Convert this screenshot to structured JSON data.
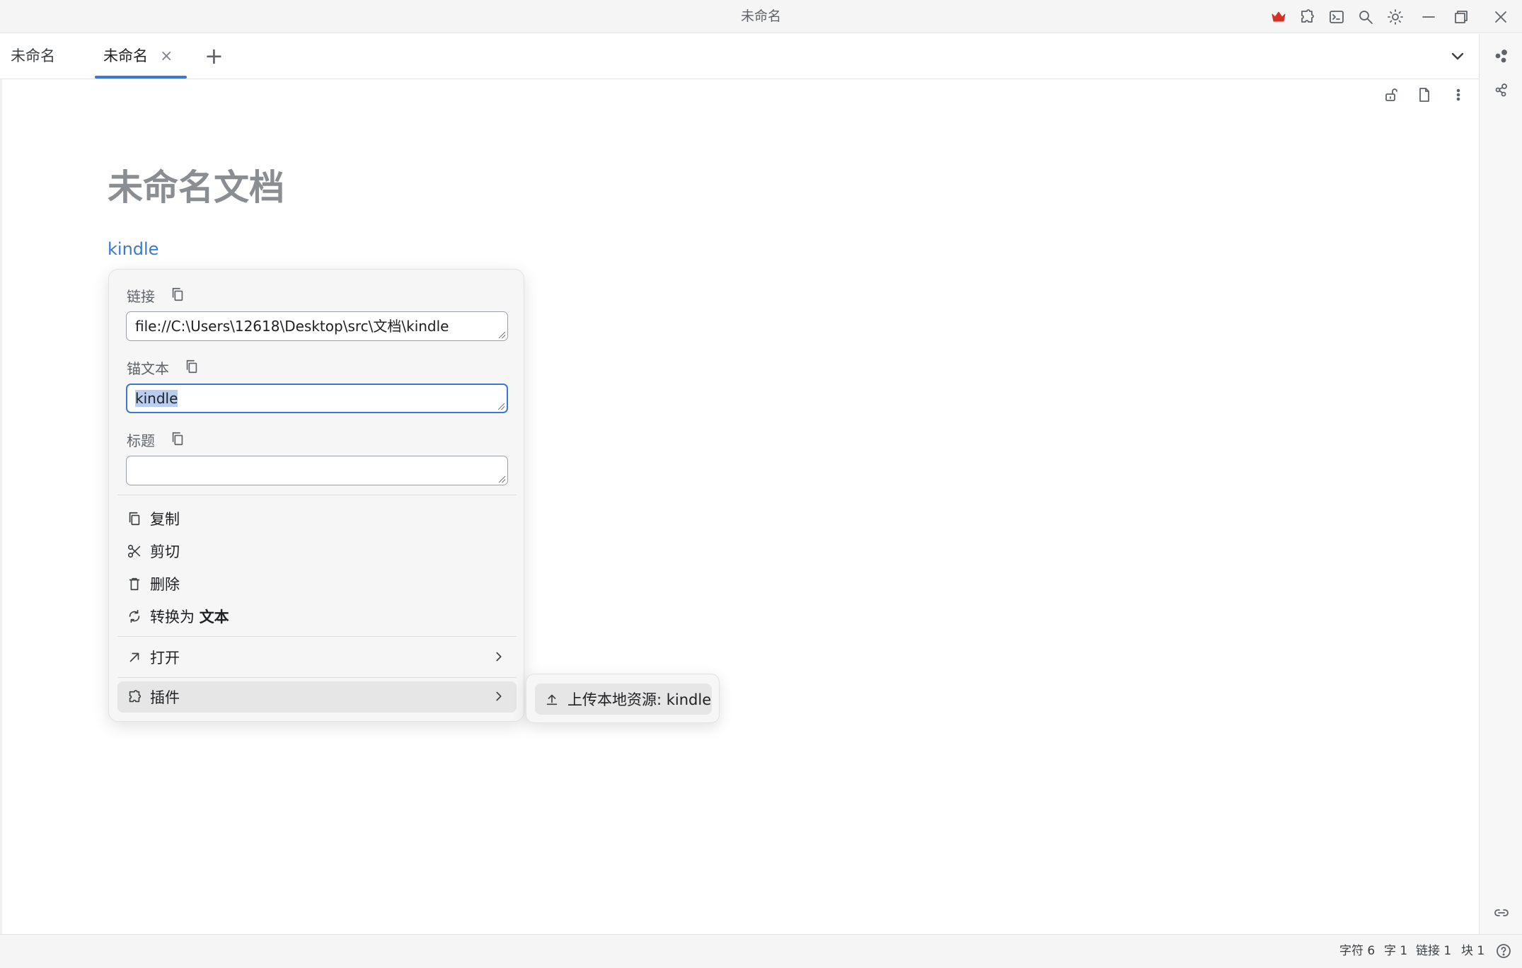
{
  "window": {
    "title": "未命名"
  },
  "tabs": [
    {
      "label": "未命名"
    },
    {
      "label": "未命名",
      "active": true,
      "close": "×"
    }
  ],
  "tab_add": "+",
  "document": {
    "title": "未命名文档",
    "link_text": "kindle"
  },
  "link_popup": {
    "link_label": "链接",
    "link_value": "file://C:\\Users\\12618\\Desktop\\src\\文档\\kindle",
    "anchor_label": "锚文本",
    "anchor_value": "kindle",
    "title_label": "标题",
    "title_value": "",
    "menu": {
      "copy": "复制",
      "cut": "剪切",
      "delete": "删除",
      "convert_prefix": "转换为 ",
      "convert_target": "文本",
      "open": "打开",
      "plugins": "插件"
    }
  },
  "submenu": {
    "upload": "上传本地资源: kindle"
  },
  "statusbar": {
    "chars_label": "字符",
    "chars_value": "6",
    "words_label": "字",
    "words_value": "1",
    "links_label": "链接",
    "links_value": "1",
    "blocks_label": "块",
    "blocks_value": "1"
  },
  "colors": {
    "accent": "#3b78d6",
    "crown": "#d93025",
    "title_gray": "#8a8d91"
  },
  "icons": [
    "crown-icon",
    "puzzle-icon",
    "terminal-icon",
    "search-icon",
    "sun-icon",
    "minimize-icon",
    "restore-icon",
    "close-icon",
    "chevron-down-icon",
    "unlock-icon",
    "file-icon",
    "more-vertical-icon",
    "graph-icon",
    "share-graph-icon",
    "link-icon",
    "help-icon",
    "copy-icon",
    "scissors-icon",
    "trash-icon",
    "refresh-icon",
    "arrow-up-right-icon",
    "chevron-right-icon",
    "upload-icon"
  ]
}
